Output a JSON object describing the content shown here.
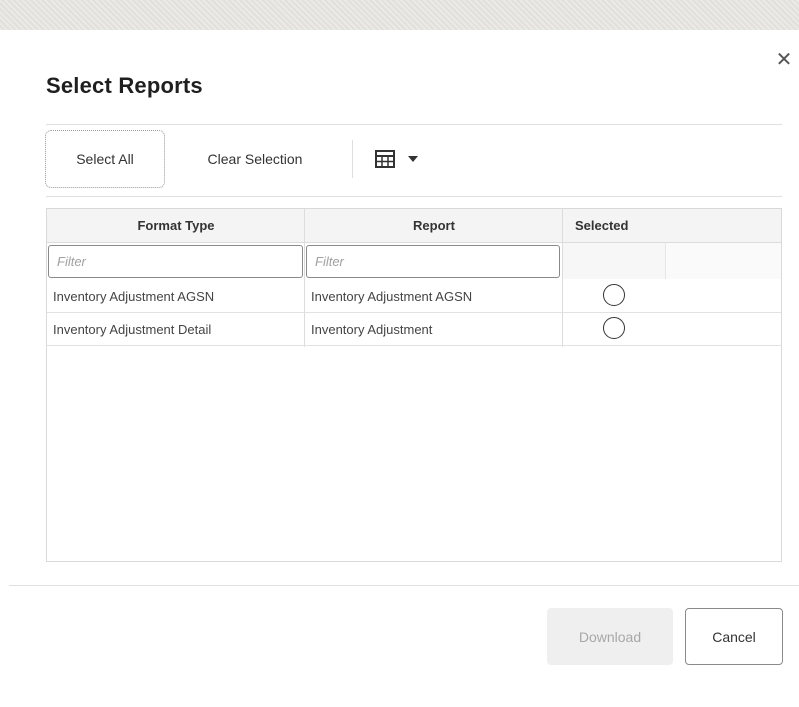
{
  "dialog": {
    "title": "Select Reports",
    "close_icon": "close-icon"
  },
  "toolbar": {
    "select_all_label": "Select All",
    "clear_selection_label": "Clear Selection",
    "view_menu_icon": "table-grid-icon"
  },
  "table": {
    "columns": [
      "Format Type",
      "Report",
      "Selected"
    ],
    "filter_placeholder": "Filter",
    "rows": [
      {
        "format_type": "Inventory Adjustment AGSN",
        "report": "Inventory Adjustment AGSN",
        "selected": false
      },
      {
        "format_type": "Inventory Adjustment Detail",
        "report": "Inventory Adjustment",
        "selected": false
      }
    ]
  },
  "footer": {
    "download_label": "Download",
    "cancel_label": "Cancel"
  }
}
